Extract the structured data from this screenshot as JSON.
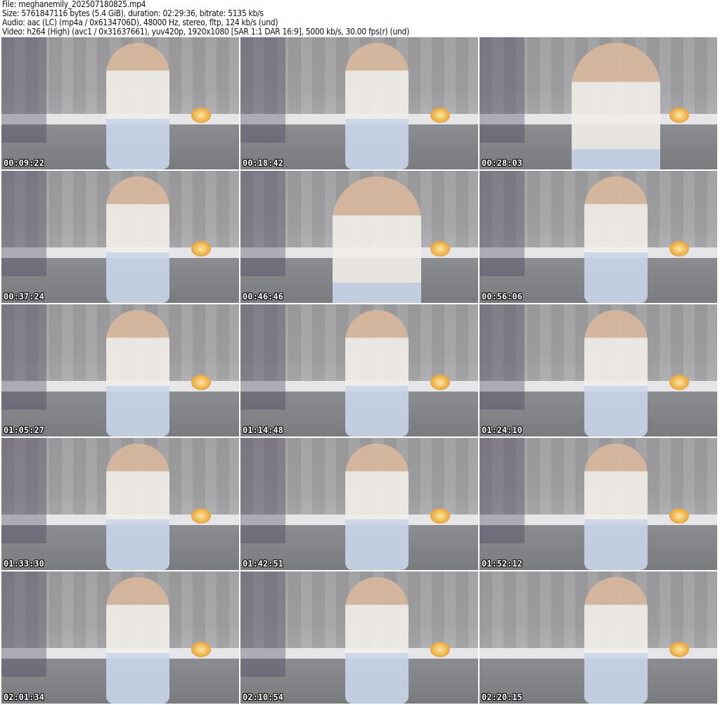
{
  "header": {
    "file": "File: meghanemily_202507180825.mp4",
    "size": "Size: 5761847116 bytes (5.4 GiB), duration: 02:29:36, bitrate: 5135 kb/s",
    "audio": "Audio: aac (LC) (mp4a / 0x6134706D), 48000 Hz, stereo, fltp, 124 kb/s (und)",
    "video": "Video: h264 (High) (avc1 / 0x31637661), yuv420p, 1920x1080 [SAR 1:1 DAR 16:9], 5000 kb/s, 30.00 fps(r) (und)"
  },
  "thumbnails": [
    {
      "timestamp": "00:09:22"
    },
    {
      "timestamp": "00:18:42"
    },
    {
      "timestamp": "00:28:03"
    },
    {
      "timestamp": "00:37:24"
    },
    {
      "timestamp": "00:46:46"
    },
    {
      "timestamp": "00:56:06"
    },
    {
      "timestamp": "01:05:27"
    },
    {
      "timestamp": "01:14:48"
    },
    {
      "timestamp": "01:24:10"
    },
    {
      "timestamp": "01:33:30"
    },
    {
      "timestamp": "01:42:51"
    },
    {
      "timestamp": "01:52:12"
    },
    {
      "timestamp": "02:01:34"
    },
    {
      "timestamp": "02:10:54"
    },
    {
      "timestamp": "02:20:15"
    }
  ]
}
